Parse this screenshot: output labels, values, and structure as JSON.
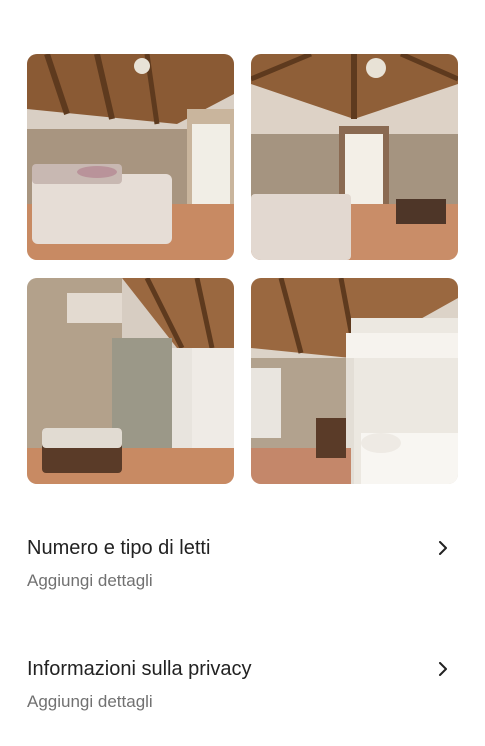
{
  "photos": [
    {
      "icon": "bedroom-photo-1"
    },
    {
      "icon": "bedroom-photo-2"
    },
    {
      "icon": "bedroom-photo-3"
    },
    {
      "icon": "bedroom-photo-4"
    }
  ],
  "rows": [
    {
      "title": "Numero e tipo di letti",
      "subtitle": "Aggiungi dettagli"
    },
    {
      "title": "Informazioni sulla privacy",
      "subtitle": "Aggiungi dettagli"
    }
  ]
}
